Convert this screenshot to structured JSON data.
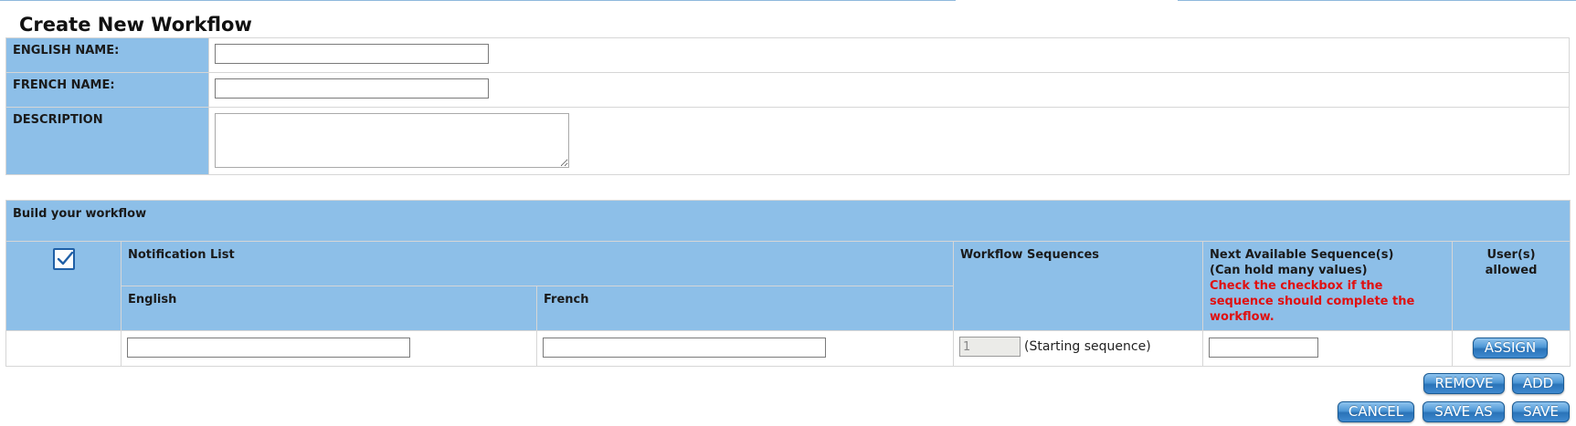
{
  "page": {
    "title": "Create New Workflow"
  },
  "form": {
    "english_name_label": "ENGLISH NAME:",
    "english_name_value": "",
    "french_name_label": "FRENCH NAME:",
    "french_name_value": "",
    "description_label": "DESCRIPTION",
    "description_value": ""
  },
  "workflow": {
    "section_title": "Build your workflow",
    "select_all_checked": true,
    "columns": {
      "notification_list": "Notification List",
      "english": "English",
      "french": "French",
      "workflow_sequences": "Workflow Sequences",
      "next_available_line1": "Next Available Sequence(s)",
      "next_available_line2": "(Can hold many values)",
      "next_available_note": "Check the checkbox if the sequence should complete the workflow.",
      "users_allowed": "User(s) allowed"
    },
    "rows": [
      {
        "english": "",
        "french": "",
        "sequence": "1",
        "sequence_note": "(Starting sequence)",
        "next_available": "",
        "assign_label": "ASSIGN"
      }
    ]
  },
  "buttons": {
    "remove": "REMOVE",
    "add": "ADD",
    "cancel": "CANCEL",
    "save_as": "SAVE AS",
    "save": "SAVE"
  },
  "colors": {
    "header_bg": "#8dbfe8",
    "button_blue": "#3f8ad0",
    "warning_red": "#e01010"
  }
}
